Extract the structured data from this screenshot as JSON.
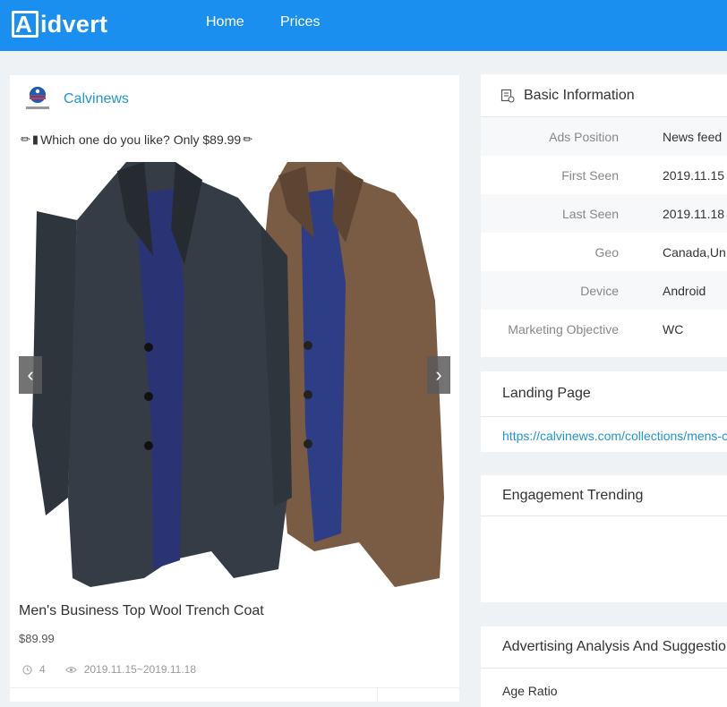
{
  "nav": {
    "brand": "idvert",
    "home": "Home",
    "prices": "Prices"
  },
  "ad": {
    "page_name": "Calvinews",
    "avatar_caption": "CALVINEWS",
    "text": "Which one do you like?  Only $89.99",
    "product_title": "Men's Business Top Wool Trench Coat",
    "price": "$89.99",
    "comment_count": "4",
    "date_range": "2019.11.15~2019.11.18",
    "carousel_prev": "‹",
    "carousel_next": "›"
  },
  "basic_info": {
    "title": "Basic Information",
    "rows": [
      {
        "label": "Ads Position",
        "value": "News feed"
      },
      {
        "label": "First Seen",
        "value": "2019.11.15"
      },
      {
        "label": "Last Seen",
        "value": "2019.11.18"
      },
      {
        "label": "Geo",
        "value": "Canada,Un"
      },
      {
        "label": "Device",
        "value": "Android"
      },
      {
        "label": "Marketing Objective",
        "value": "WC"
      }
    ]
  },
  "landing_page": {
    "title": "Landing Page",
    "url": "https://calvinews.com/collections/mens-c"
  },
  "engagement": {
    "title": "Engagement Trending"
  },
  "advertising": {
    "title": "Advertising Analysis And Suggestio",
    "age_ratio": "Age Ratio"
  },
  "colors": {
    "topbar": "#1a8ff0",
    "link": "#2196d3",
    "background": "#eef2f5"
  }
}
